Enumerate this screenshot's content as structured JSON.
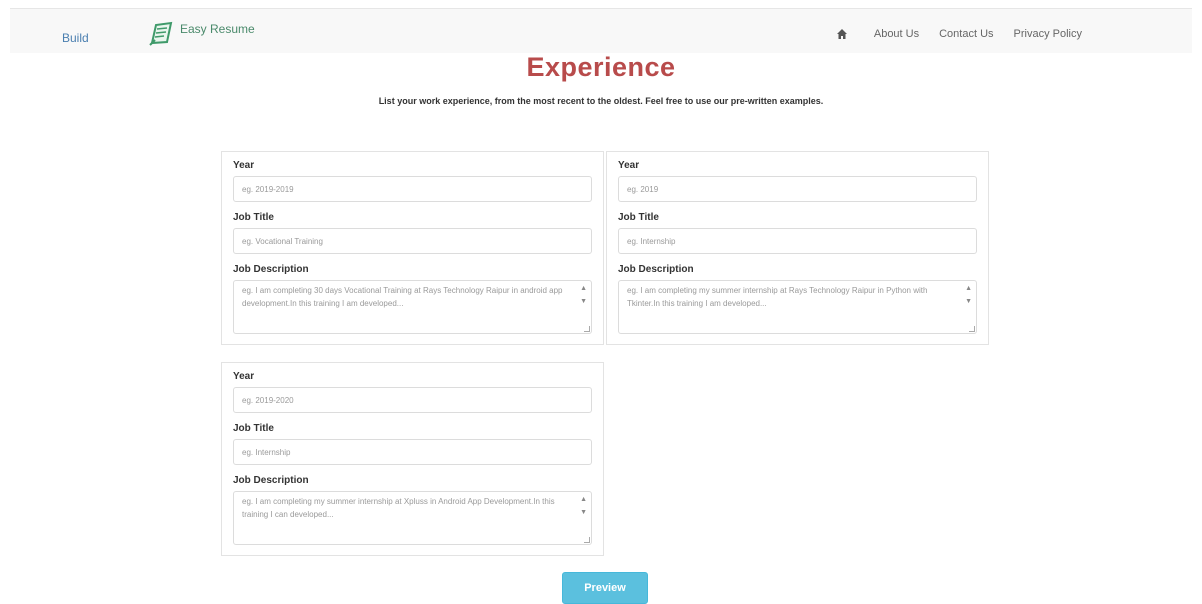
{
  "header": {
    "build_link": "Build",
    "logo_text": "Easy Resume",
    "nav": [
      "About Us",
      "Contact Us",
      "Privacy Policy"
    ]
  },
  "page": {
    "title": "Experience",
    "subtitle": "List your work experience, from the most recent to the oldest. Feel free to use our pre-written examples."
  },
  "labels": {
    "year": "Year",
    "job_title": "Job Title",
    "job_description": "Job Description"
  },
  "entries": [
    {
      "year_placeholder": "eg. 2019-2019",
      "title_placeholder": "eg. Vocational Training",
      "description_placeholder": "eg. I am completing 30 days Vocational Training at Rays Technology Raipur in android app development.In this training I am developed..."
    },
    {
      "year_placeholder": "eg. 2019",
      "title_placeholder": "eg. Internship",
      "description_placeholder": "eg. I am completing my summer internship at Rays Technology Raipur in Python with Tkinter.In this training I am developed..."
    },
    {
      "year_placeholder": "eg. 2019-2020",
      "title_placeholder": "eg. Internship",
      "description_placeholder": "eg. I am completing my summer internship at Xpluss in Android App Development.In this training I can developed..."
    }
  ],
  "preview_label": "Preview",
  "colors": {
    "title": "#b84b4b",
    "preview_button": "#5bc0de",
    "logo": "#4a8a6b"
  }
}
